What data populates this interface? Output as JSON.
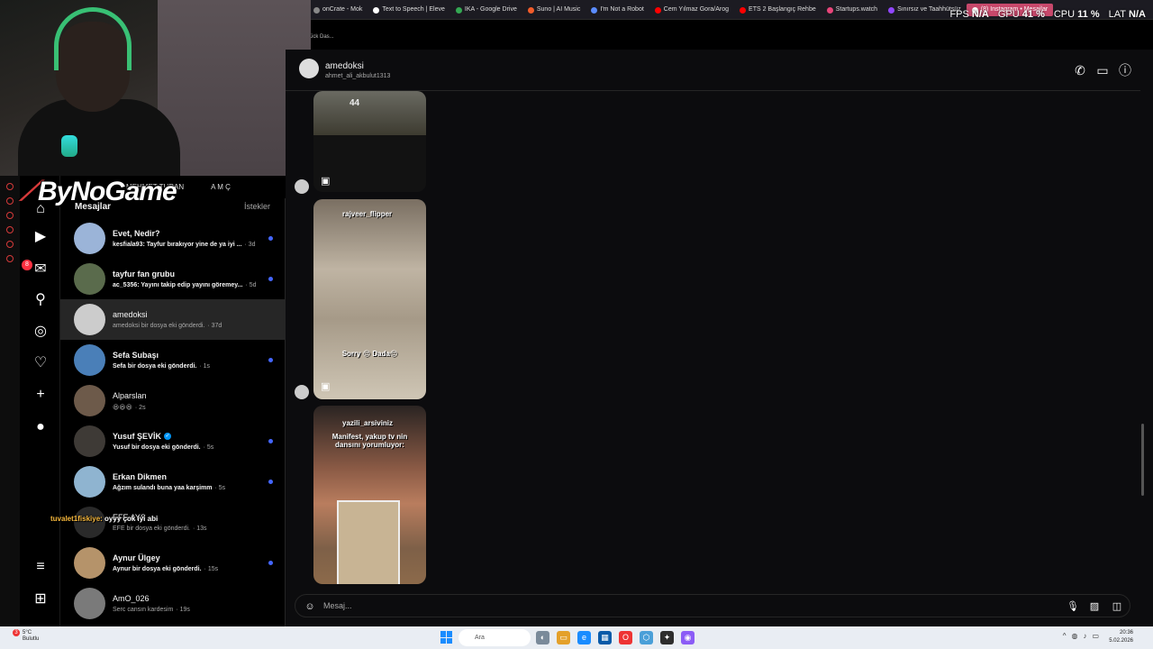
{
  "browser": {
    "tabs": [
      {
        "label": "onCrate - Mok",
        "color": "#888888"
      },
      {
        "label": "Text to Speech | Eleve",
        "color": "#ffffff"
      },
      {
        "label": "IKA - Google Drive",
        "color": "#34a853"
      },
      {
        "label": "Suno | AI Music",
        "color": "#f25c2a"
      },
      {
        "label": "I'm Not a Robot",
        "color": "#5b8cff"
      },
      {
        "label": "Cem Yılmaz Gora/Arog",
        "color": "#ff0000"
      },
      {
        "label": "ETS 2 Başlangıç Rehbe",
        "color": "#ff0000"
      },
      {
        "label": "Startups.watch",
        "color": "#e8457a"
      },
      {
        "label": "Sınırsız ve Taahhütsüz",
        "color": "#9146ff"
      },
      {
        "label": "(8) Instagram • Mesajlar",
        "color": "#ffffff"
      }
    ],
    "second_row": "Kick Das..."
  },
  "stats": {
    "fps_label": "FPS",
    "fps": "N/A",
    "gpu_label": "GPU",
    "gpu": "41 %",
    "cpu_label": "CPU",
    "cpu": "11 %",
    "lat_label": "LAT",
    "lat": "N/A"
  },
  "logo": {
    "brand": "ByNoGame"
  },
  "stories": {
    "a": "MEHMET TURAN",
    "b": "A M Ç"
  },
  "sidebar": {
    "notif_count": "8"
  },
  "conversations": {
    "heading": "Mesajlar",
    "requests": "İstekler",
    "items": [
      {
        "name": "Evet, Nedir?",
        "preview": "kesfiala93: Tayfur bırakıyor yine de ya iyi ...",
        "time": "· 3d",
        "unread": true,
        "color": "#9bb4d8"
      },
      {
        "name": "tayfur fan grubu",
        "preview": "ac_5356: Yayını takip edip yayını göremey...",
        "time": "· 5d",
        "unread": true,
        "color": "#5a6b4c"
      },
      {
        "name": "amedoksi",
        "preview": "amedoksi bir dosya eki gönderdi.",
        "time": "· 37d",
        "unread": false,
        "color": "#cccccc"
      },
      {
        "name": "Sefa Subaşı",
        "preview": "Sefa bir dosya eki gönderdi.",
        "time": "· 1s",
        "unread": true,
        "color": "#4a7fb8"
      },
      {
        "name": "Alparslan",
        "preview": "😆😆😆",
        "time": "· 2s",
        "unread": false,
        "color": "#6d5a4a"
      },
      {
        "name": "Yusuf ŞEVİK",
        "preview": "Yusuf bir dosya eki gönderdi.",
        "time": "· 5s",
        "unread": true,
        "color": "#3e3a36",
        "verified": true
      },
      {
        "name": "Erkan Dikmen",
        "preview": "Ağzım sulandı buna yaa karşimm",
        "time": "· 5s",
        "unread": true,
        "color": "#8fb4d0"
      },
      {
        "name": "EFE AYS",
        "preview": "EFE bir dosya eki gönderdi.",
        "time": "· 13s",
        "unread": false,
        "color": "#2a2a2a"
      },
      {
        "name": "Aynur Ülgey",
        "preview": "Aynur bir dosya eki gönderdi.",
        "time": "· 15s",
        "unread": true,
        "color": "#b5936a"
      },
      {
        "name": "AmO_026",
        "preview": "Serc cansın kardesim",
        "time": "· 19s",
        "unread": false,
        "color": "#7a7a7a"
      }
    ]
  },
  "stream_chat": {
    "user": "tuvalet1fiskiye:",
    "message": "oyyy çok iyi abi"
  },
  "chat": {
    "name": "amedoksi",
    "username": "ahmet_ali_akbulut1313",
    "reel2_user": "rajveer_flipper",
    "reel2_caption": "Sorry 😔 Dada😔",
    "reel3_user": "yazili_arsiviniz",
    "reel3_caption": "Manifest, yakup tv nin dansını yorumluyor:",
    "reel1_number": "44",
    "input_placeholder": "Mesaj..."
  },
  "taskbar": {
    "temp": "5°C",
    "weather": "Bulutlu",
    "weather_badge": "3",
    "search": "Ara",
    "time": "20:36",
    "date": "5.02.2026"
  }
}
